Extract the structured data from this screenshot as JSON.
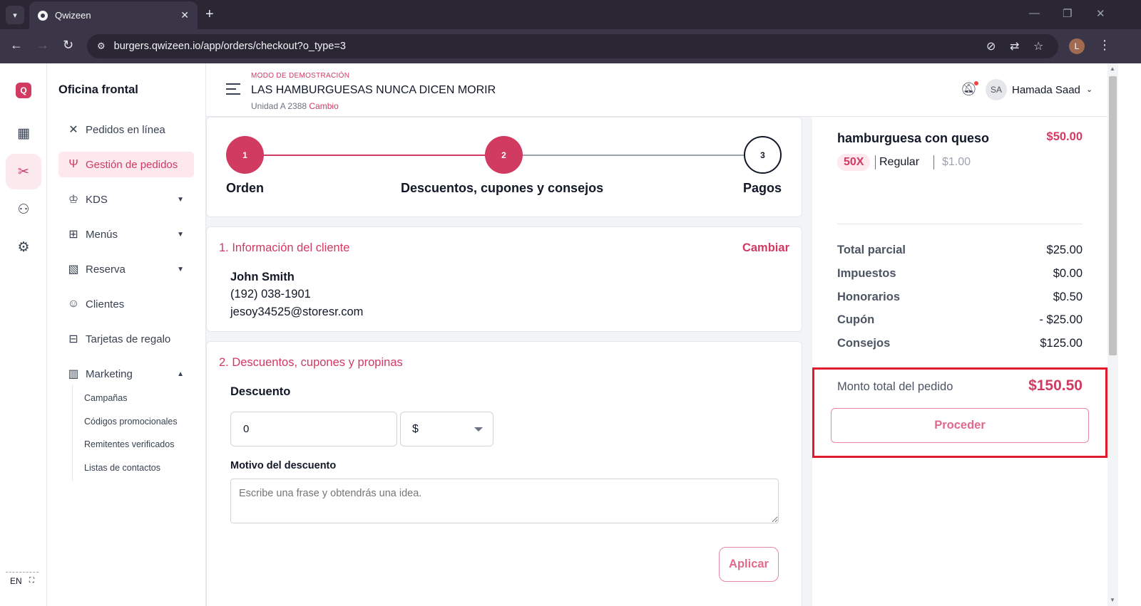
{
  "browser": {
    "tab_title": "Qwizeen",
    "url": "burgers.qwizeen.io/app/orders/checkout?o_type=3",
    "profile_initial": "L"
  },
  "sidebar": {
    "title": "Oficina frontal",
    "items": [
      {
        "label": "Pedidos en línea"
      },
      {
        "label": "Gestión de pedidos"
      },
      {
        "label": "KDS"
      },
      {
        "label": "Menús"
      },
      {
        "label": "Reserva"
      },
      {
        "label": "Clientes"
      },
      {
        "label": "Tarjetas de regalo"
      },
      {
        "label": "Marketing"
      }
    ],
    "marketing_sub": [
      "Campañas",
      "Códigos promocionales",
      "Remitentes verificados",
      "Listas de contactos"
    ],
    "language": "EN"
  },
  "header": {
    "demo_mode": "MODO DE DEMOSTRACIÓN",
    "store_name": "LAS HAMBURGUESAS NUNCA DICEN MORIR",
    "unit": "Unidad A 2388",
    "change": "Cambio",
    "user_initials": "SA",
    "user_name": "Hamada Saad"
  },
  "stepper": {
    "steps": [
      {
        "number": "1",
        "label": "Orden",
        "status": "done"
      },
      {
        "number": "2",
        "label": "Descuentos, cupones y consejos",
        "status": "done"
      },
      {
        "number": "3",
        "label": "Pagos",
        "status": "pending"
      }
    ]
  },
  "customer": {
    "section_title": "1. Información del cliente",
    "change_label": "Cambiar",
    "name": "John Smith",
    "phone": "(192) 038-1901",
    "email": "jesoy34525@storesr.com"
  },
  "discounts": {
    "section_title": "2. Descuentos, cupones y propinas",
    "discount_label": "Descuento",
    "discount_value": "0",
    "discount_type": "$",
    "reason_label": "Motivo del descuento",
    "reason_placeholder": "Escribe una frase y obtendrás una idea.",
    "apply_label": "Aplicar"
  },
  "summary": {
    "item_name": "hamburguesa con queso",
    "item_price": "$50.00",
    "quantity": "50X",
    "variant": "Regular",
    "variant_price": "$1.00",
    "rows": [
      {
        "label": "Total parcial",
        "value": "$25.00"
      },
      {
        "label": "Impuestos",
        "value": "$0.00"
      },
      {
        "label": "Honorarios",
        "value": "$0.50"
      },
      {
        "label": "Cupón",
        "value": "- $25.00"
      },
      {
        "label": "Consejos",
        "value": "$125.00"
      }
    ],
    "total_label": "Monto total del pedido",
    "total_value": "$150.50",
    "proceed_label": "Proceder"
  },
  "colors": {
    "accent": "#d13a61",
    "highlight_border": "#e01a2b"
  }
}
